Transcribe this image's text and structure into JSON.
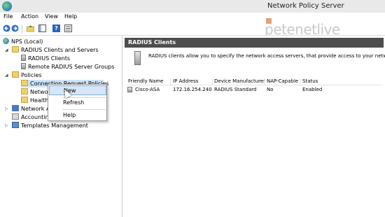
{
  "window": {
    "title": "Network Policy Server"
  },
  "menu": [
    "File",
    "Action",
    "View",
    "Help"
  ],
  "toolbar": {
    "help_glyph": "?"
  },
  "watermark": "petenetlive",
  "tree": {
    "root": "NPS (Local)",
    "radius_group": "RADIUS Clients and Servers",
    "radius_clients": "RADIUS Clients",
    "remote_groups": "Remote RADIUS Server Groups",
    "policies": "Policies",
    "connection_request": "Connection Request Policies",
    "network_policies": "Netwo",
    "health_policies": "Health",
    "network_access": "Network A",
    "accounting": "Accountin",
    "templates": "Templates Management"
  },
  "context_menu": {
    "new": "New",
    "refresh": "Refresh",
    "help": "Help"
  },
  "content": {
    "header": "RADIUS Clients",
    "description": "RADIUS clients allow you to specify the network access servers, that provide access to your network.",
    "columns": [
      "Friendly Name",
      "IP Address",
      "Device Manufacturer",
      "NAP-Capable",
      "Status"
    ],
    "rows": [
      {
        "name": "Cisco-ASA",
        "ip": "172.16.254.240",
        "manufacturer": "RADIUS Standard",
        "nap": "No",
        "status": "Enabled"
      }
    ]
  }
}
